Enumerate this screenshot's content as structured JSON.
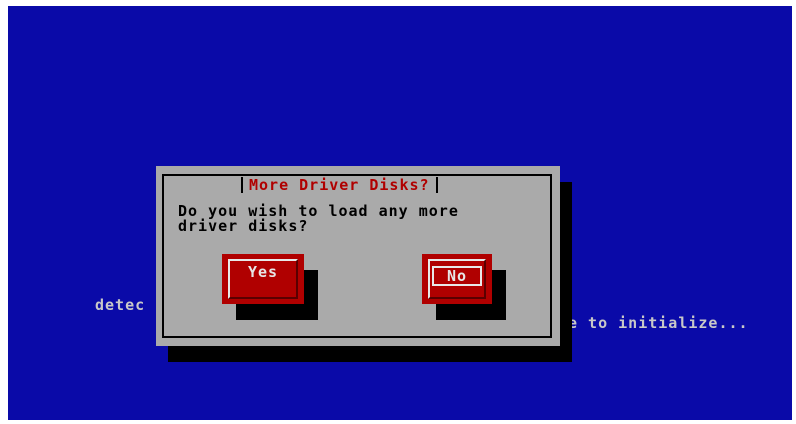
{
  "background": {
    "color": "#0a0aa8",
    "text_left": "detec",
    "text_right": "e to initialize..."
  },
  "dialog": {
    "title": "More Driver Disks?",
    "message_line1": "Do you wish to load any more",
    "message_line2": "driver disks?",
    "yes_label": "Yes",
    "no_label": "No",
    "accent_color": "#b00000",
    "body_color": "#aaaaaa"
  }
}
